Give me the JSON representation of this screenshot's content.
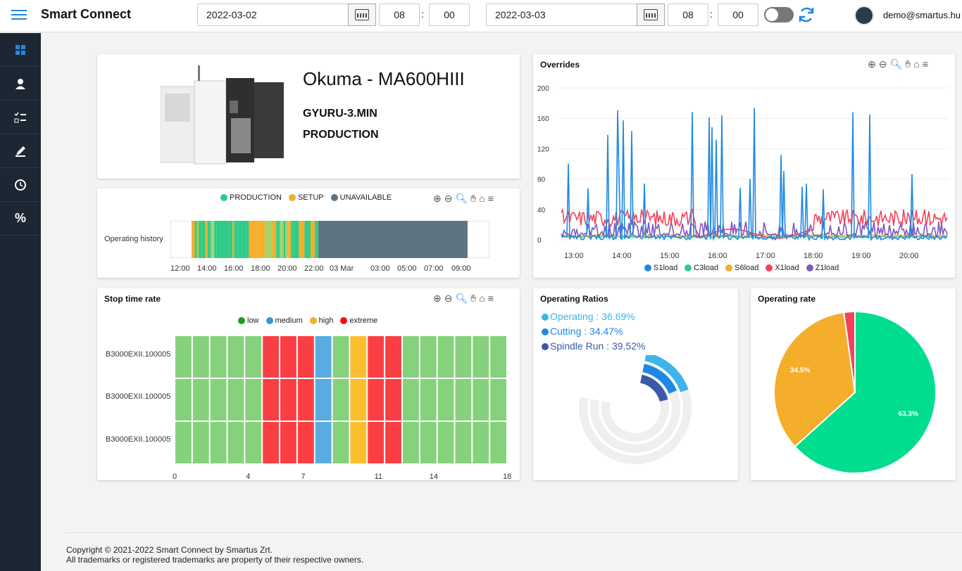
{
  "app": {
    "title": "Smart Connect"
  },
  "filters": {
    "start_date": "2022-03-02",
    "start_hour": "08",
    "start_min": "00",
    "end_date": "2022-03-03",
    "end_hour": "08",
    "end_min": "00"
  },
  "user": {
    "email": "demo@smartus.hu"
  },
  "sidebar": {
    "items": [
      "dashboard-icon",
      "person-icon",
      "checklist-icon",
      "edit-icon",
      "clock-icon",
      "percent-icon"
    ]
  },
  "machine": {
    "name": "Okuma - MA600HIII",
    "program": "GYURU-3.MIN",
    "state": "PRODUCTION"
  },
  "history": {
    "legend": [
      {
        "label": "PRODUCTION",
        "color": "#2ecc8a"
      },
      {
        "label": "SETUP",
        "color": "#f5ad2c"
      },
      {
        "label": "UNAVAILABLE",
        "color": "#5f7482"
      }
    ],
    "row_label": "Operating history",
    "x_ticks": [
      "12:00",
      "14:00",
      "16:00",
      "18:00",
      "20:00",
      "22:00",
      "03 Mar",
      "03:00",
      "05:00",
      "07:00",
      "09:00"
    ]
  },
  "overrides": {
    "title": "Overrides",
    "y_ticks": [
      "200",
      "160",
      "120",
      "80",
      "40",
      "0"
    ],
    "x_ticks": [
      "13:00",
      "14:00",
      "15:00",
      "16:00",
      "17:00",
      "18:00",
      "19:00",
      "20:00"
    ],
    "legend": [
      {
        "label": "S1load",
        "color": "#1e88e5"
      },
      {
        "label": "C3load",
        "color": "#2ecc8a"
      },
      {
        "label": "S6load",
        "color": "#f5ad2c"
      },
      {
        "label": "X1load",
        "color": "#f4425c"
      },
      {
        "label": "Z1load",
        "color": "#7e57c2"
      }
    ]
  },
  "stop": {
    "title": "Stop time rate",
    "legend": [
      {
        "label": "low",
        "color": "#1a9e1a"
      },
      {
        "label": "medium",
        "color": "#3399dd"
      },
      {
        "label": "high",
        "color": "#f5ad2c"
      },
      {
        "label": "extreme",
        "color": "#ee1111"
      }
    ],
    "rows": [
      "B3000EXII.100005",
      "B3000EXII.100005",
      "B3000EXII.100005"
    ],
    "x_ticks": [
      "0",
      "4",
      "7",
      "11",
      "14",
      "18"
    ],
    "cells": [
      "low",
      "low",
      "low",
      "low",
      "low",
      "extreme",
      "extreme",
      "extreme",
      "medium",
      "low",
      "high",
      "extreme",
      "extreme",
      "low",
      "low",
      "low",
      "low",
      "low",
      "low"
    ]
  },
  "ratios": {
    "title": "Operating Ratios",
    "items": [
      {
        "label": "Operating : 36.69%",
        "color": "#3db4ea",
        "value": 36.69
      },
      {
        "label": "Cutting : 34.47%",
        "color": "#1e88e5",
        "value": 34.47
      },
      {
        "label": "Spindle Run : 39.52%",
        "color": "#3a5aa8",
        "value": 39.52
      }
    ]
  },
  "rate": {
    "title": "Operating rate",
    "slices": [
      {
        "label": "63.3%",
        "value": 63.3,
        "color": "#00dd8e"
      },
      {
        "label": "34.5%",
        "value": 34.5,
        "color": "#f5ad2c"
      },
      {
        "label": "",
        "value": 2.2,
        "color": "#f4425c"
      }
    ]
  },
  "footer": {
    "line1": "Copyright © 2021-2022 Smart Connect by Smartus Zrt.",
    "line2": "All trademarks or registered trademarks are property of their respective owners."
  }
}
